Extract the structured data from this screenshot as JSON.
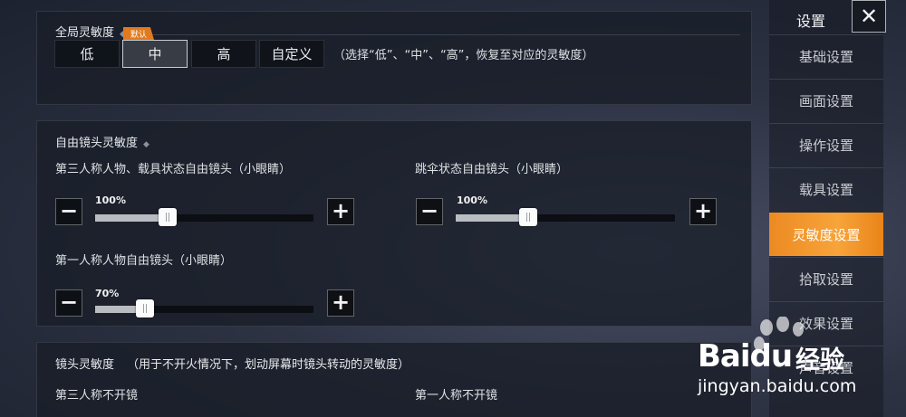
{
  "global_sensitivity": {
    "title": "全局灵敏度",
    "modes": [
      "低",
      "中",
      "高",
      "自定义"
    ],
    "selected_mode": "中",
    "default_tag": "默认",
    "hint": "（选择“低”、“中”、“高”，恢复至对应的灵敏度）"
  },
  "free_look": {
    "title": "自由镜头灵敏度",
    "sliders": [
      {
        "label": "第三人称人物、载具状态自由镜头（小眼睛）",
        "value_text": "100%",
        "fraction": 0.33
      },
      {
        "label": "跳伞状态自由镜头（小眼睛）",
        "value_text": "100%",
        "fraction": 0.33
      },
      {
        "label": "第一人称人物自由镜头（小眼睛）",
        "value_text": "70%",
        "fraction": 0.23
      }
    ],
    "minus_glyph": "−",
    "plus_glyph": "+"
  },
  "camera_sensitivity": {
    "title": "镜头灵敏度",
    "note": "（用于不开火情况下，划动屏幕时镜头转动的灵敏度）",
    "col_third": "第三人称不开镜",
    "col_first": "第一人称不开镜"
  },
  "sidebar": {
    "title": "设置",
    "close_glyph": "✕",
    "items": [
      "基础设置",
      "画面设置",
      "操作设置",
      "载具设置",
      "灵敏度设置",
      "拾取设置",
      "效果设置",
      "声音设置"
    ],
    "active_item": "灵敏度设置"
  },
  "watermark": {
    "brand_a": "Bai",
    "brand_b": "du",
    "brand_cn": "经验",
    "url": "jingyan.baidu.com"
  },
  "colors": {
    "accent": "#f09a2c",
    "default_tag": "#e07a1c"
  }
}
